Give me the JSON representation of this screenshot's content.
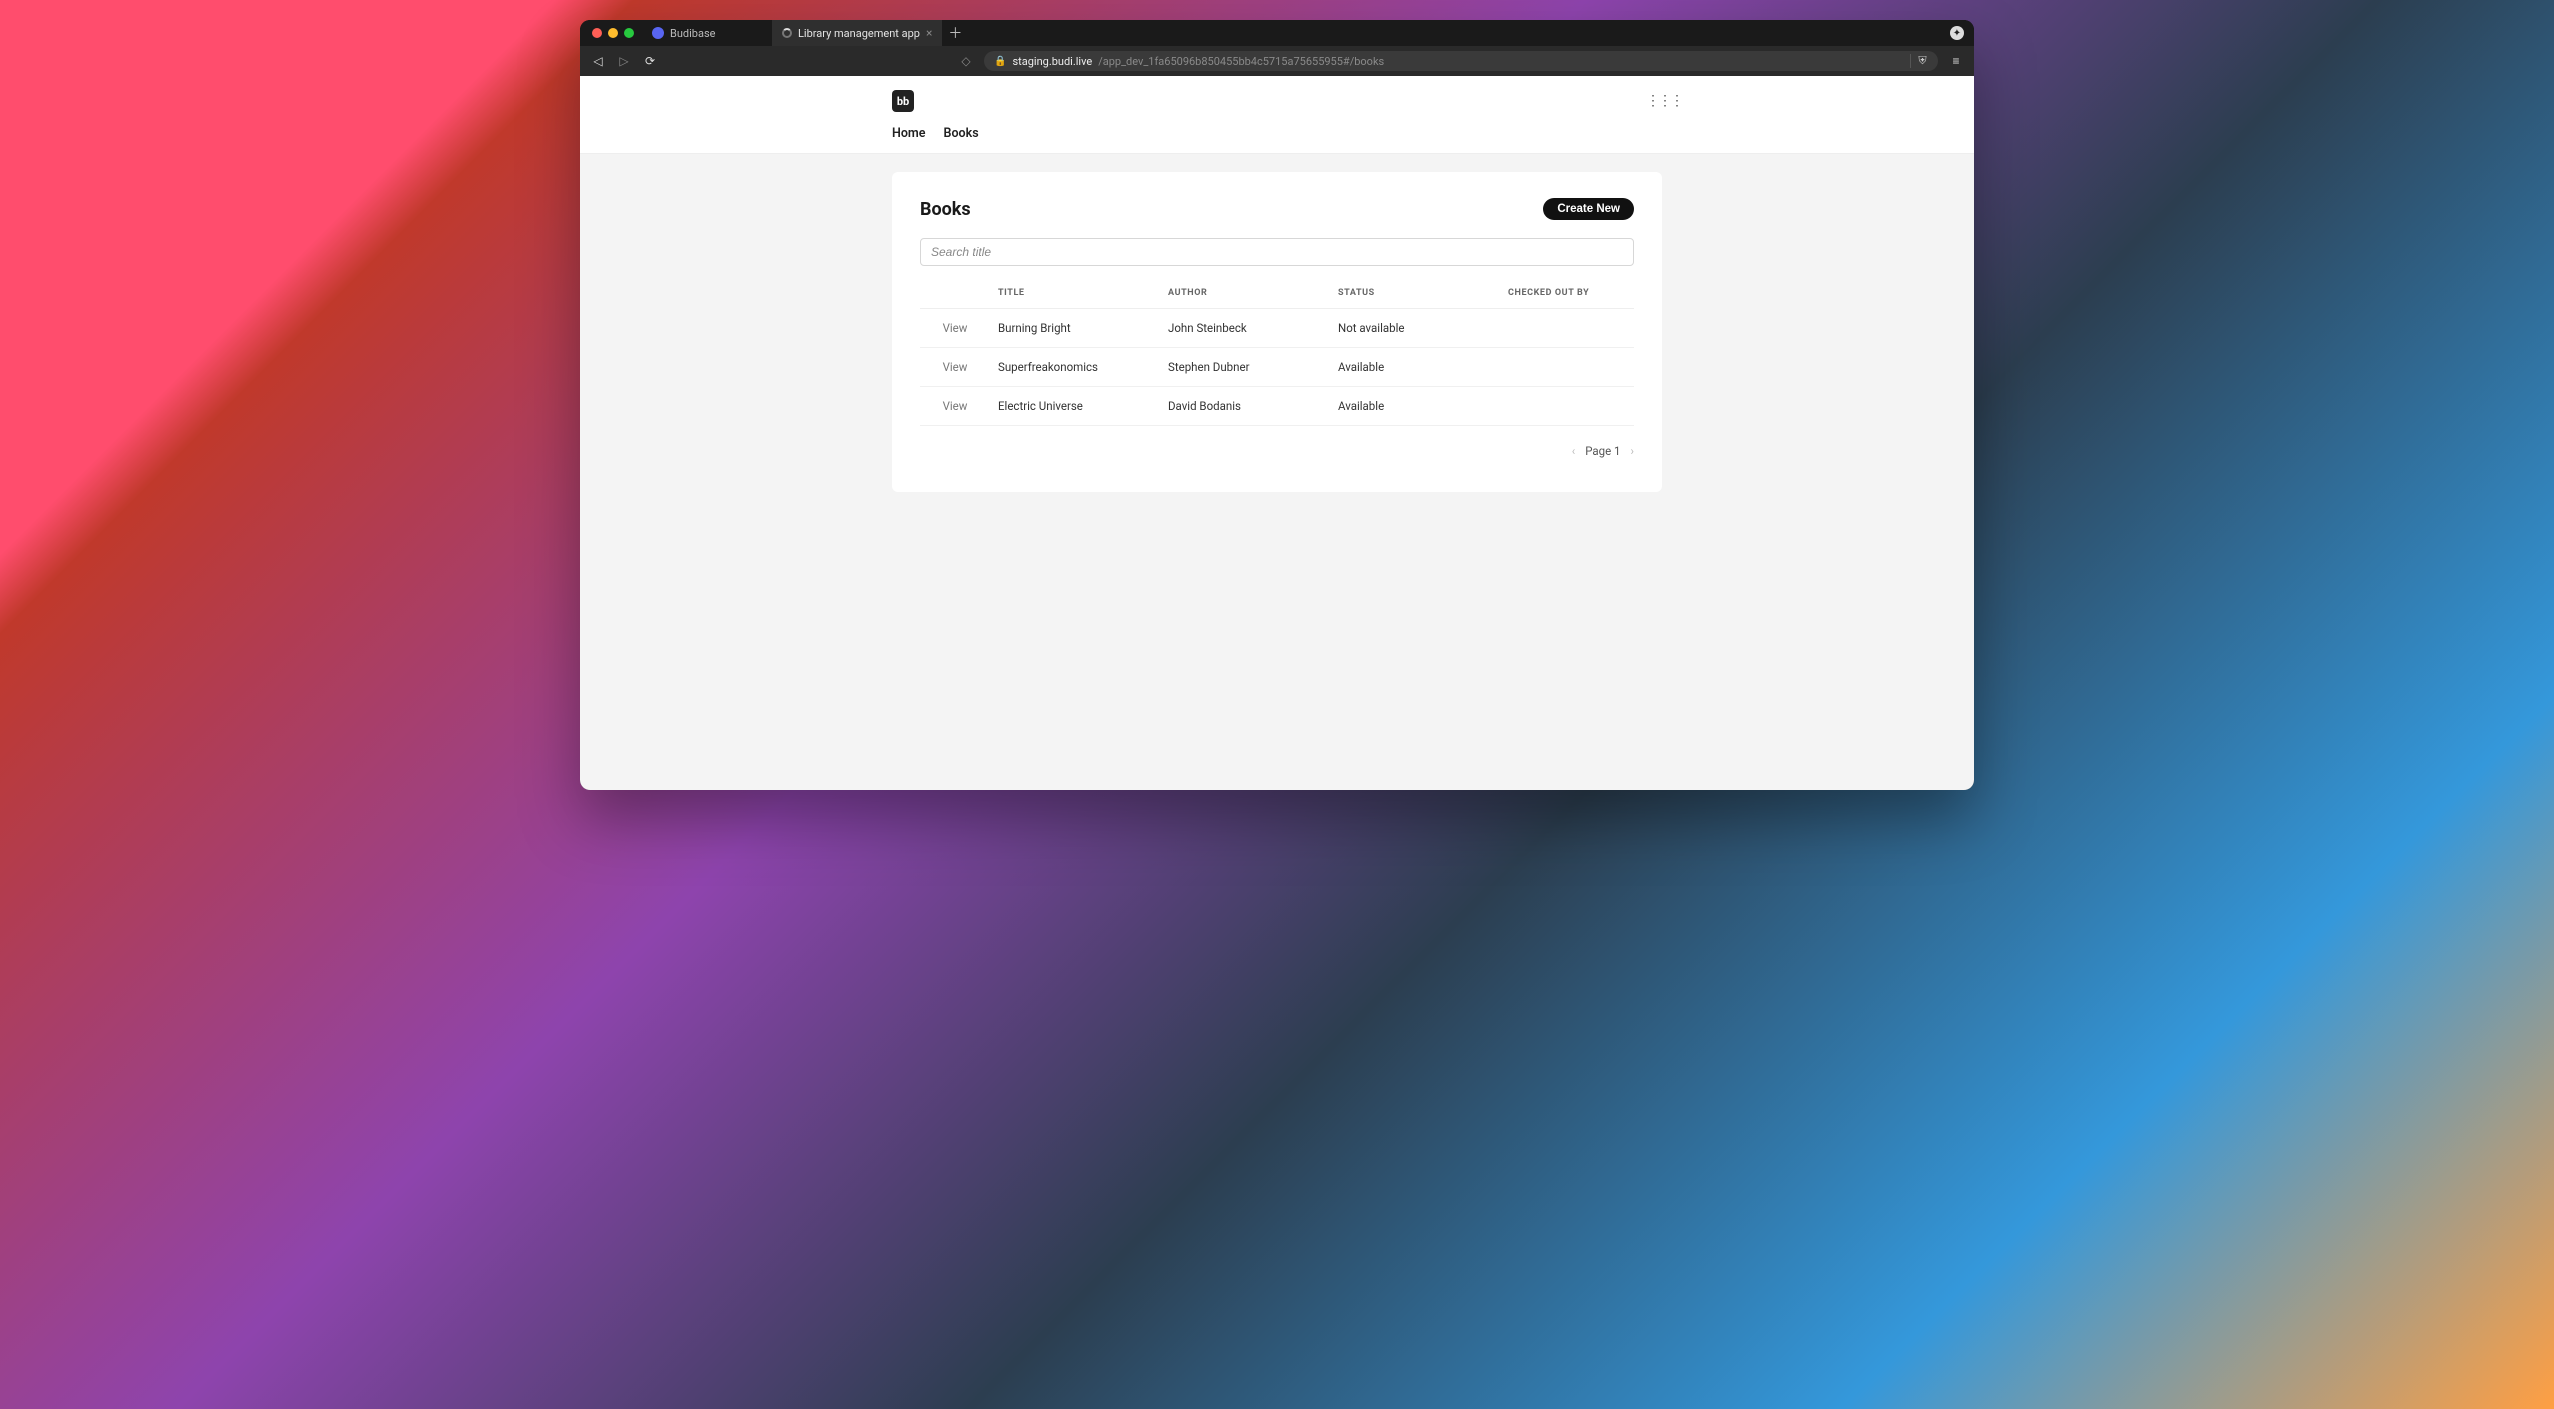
{
  "browser": {
    "tabs": [
      {
        "label": "Budibase",
        "active": false
      },
      {
        "label": "Library management app",
        "active": true
      }
    ],
    "url_host": "staging.budi.live",
    "url_path": "/app_dev_1fa65096b850455bb4c5715a75655955#/books"
  },
  "header": {
    "brand_text": "bb",
    "nav": [
      {
        "label": "Home"
      },
      {
        "label": "Books"
      }
    ]
  },
  "page": {
    "title": "Books",
    "create_label": "Create New",
    "search_placeholder": "Search title",
    "columns": {
      "view": "",
      "title": "TITLE",
      "author": "AUTHOR",
      "status": "STATUS",
      "checked_out_by": "CHECKED OUT BY"
    },
    "view_label": "View",
    "rows": [
      {
        "title": "Burning Bright",
        "author": "John Steinbeck",
        "status": "Not available",
        "checked_out_by": ""
      },
      {
        "title": "Superfreakonomics",
        "author": "Stephen Dubner",
        "status": "Available",
        "checked_out_by": ""
      },
      {
        "title": "Electric Universe",
        "author": "David Bodanis",
        "status": "Available",
        "checked_out_by": ""
      }
    ],
    "pager": {
      "label": "Page 1"
    }
  }
}
